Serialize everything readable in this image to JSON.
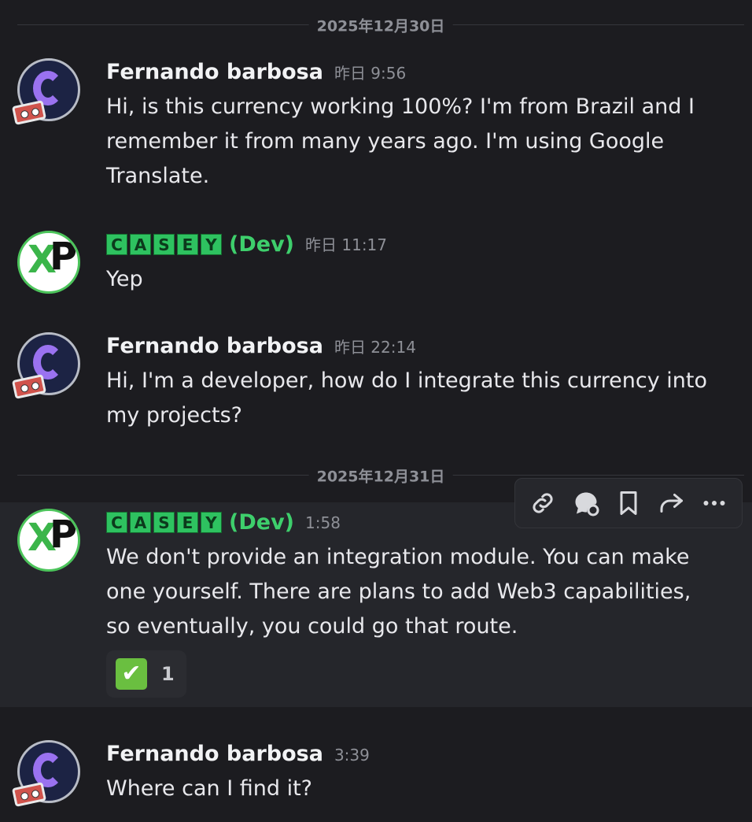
{
  "dates": {
    "first": "2025年12月30日",
    "second": "2025年12月31日"
  },
  "messages": [
    {
      "author": "Fernando barbosa",
      "time": "昨日 9:56",
      "text": "Hi, is this currency working 100%? I'm from Brazil and I remember it from many years ago. I'm using Google Translate."
    },
    {
      "author_letters": [
        "C",
        "A",
        "S",
        "E",
        "Y"
      ],
      "author_suffix": "(Dev)",
      "time": "昨日 11:17",
      "text": "Yep"
    },
    {
      "author": "Fernando barbosa",
      "time": "昨日 22:14",
      "text": "Hi, I'm a developer, how do I integrate this currency into my projects?"
    },
    {
      "author_letters": [
        "C",
        "A",
        "S",
        "E",
        "Y"
      ],
      "author_suffix": "(Dev)",
      "time": "1:58",
      "text": "We don't provide an integration module. You can make one yourself. There are plans to add Web3 capabilities, so eventually, you could go that route.",
      "reaction": {
        "emoji": "✔",
        "count": "1"
      }
    },
    {
      "author": "Fernando barbosa",
      "time": "3:39",
      "text": "Where can I find it?"
    }
  ],
  "toolbar": [
    "link-icon",
    "thread-icon",
    "bookmark-icon",
    "forward-icon",
    "more-icon"
  ],
  "colors": {
    "accent_green": "#3ecf6c",
    "background": "#1c1c20"
  }
}
